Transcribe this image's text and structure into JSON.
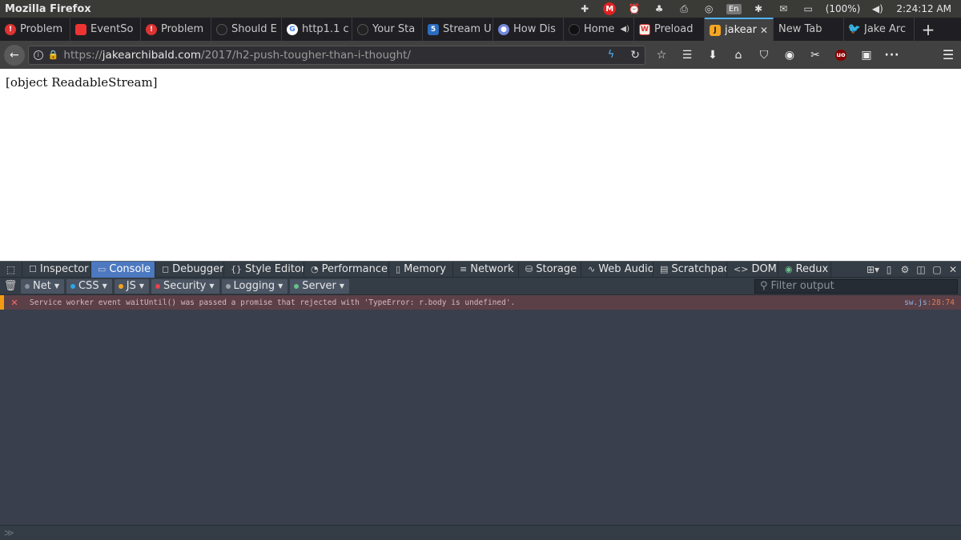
{
  "os": {
    "app_title": "Mozilla Firefox",
    "keyboard": "En",
    "battery": "(100%)",
    "clock": "2:24:12 AM"
  },
  "tabs": [
    {
      "label": "Problem",
      "favicon": "error-icon"
    },
    {
      "label": "EventSo",
      "favicon": "event-icon"
    },
    {
      "label": "Problem",
      "favicon": "error-icon"
    },
    {
      "label": "Should E",
      "favicon": "github-icon"
    },
    {
      "label": "http1.1 c",
      "favicon": "google-icon"
    },
    {
      "label": "Your Sta",
      "favicon": "github-icon"
    },
    {
      "label": "Stream U",
      "favicon": "css-icon"
    },
    {
      "label": "How Dis",
      "favicon": "discord-icon"
    },
    {
      "label": "Home",
      "favicon": "home-icon"
    },
    {
      "label": "Preload",
      "favicon": "ws-icon"
    },
    {
      "label": "jakear",
      "favicon": "j-icon",
      "active": true
    },
    {
      "label": "New Tab",
      "favicon": ""
    },
    {
      "label": "Jake Arc",
      "favicon": "twitter-icon"
    }
  ],
  "urlbar": {
    "scheme": "https://",
    "host": "jakearchibald.com",
    "path": "/2017/h2-push-tougher-than-i-thought/"
  },
  "page": {
    "content": "[object ReadableStream]"
  },
  "devtools": {
    "tabs": [
      {
        "label": "Inspector",
        "icon": "inspector-icon"
      },
      {
        "label": "Console",
        "icon": "console-icon",
        "active": true
      },
      {
        "label": "Debugger",
        "icon": "debugger-icon"
      },
      {
        "label": "Style Editor",
        "icon": "style-editor-icon"
      },
      {
        "label": "Performance",
        "icon": "performance-icon"
      },
      {
        "label": "Memory",
        "icon": "memory-icon"
      },
      {
        "label": "Network",
        "icon": "network-icon"
      },
      {
        "label": "Storage",
        "icon": "storage-icon"
      },
      {
        "label": "Web Audio",
        "icon": "web-audio-icon"
      },
      {
        "label": "Scratchpad",
        "icon": "scratchpad-icon"
      },
      {
        "label": "DOM",
        "icon": "dom-icon"
      },
      {
        "label": "Redux",
        "icon": "redux-icon"
      }
    ],
    "filters": [
      {
        "label": "Net",
        "color": "#8a929c"
      },
      {
        "label": "CSS",
        "color": "#2aa8e6"
      },
      {
        "label": "JS",
        "color": "#f7a21b"
      },
      {
        "label": "Security",
        "color": "#e8424a"
      },
      {
        "label": "Logging",
        "color": "#9ea4ac"
      },
      {
        "label": "Server",
        "color": "#6ac28a"
      }
    ],
    "filter_placeholder": "Filter output",
    "message": {
      "text": "Service worker event waitUntil() was passed a promise that rejected with 'TypeError: r.body is undefined'.",
      "file": "sw.js",
      "location": ":28:74"
    },
    "input_prompt": "≫"
  },
  "colors": {
    "active_tab_accent": "#4fb3ff",
    "devtools_bg": "#393f4c",
    "error_row_bg": "#5b4048",
    "error_marker": "#f39c12"
  }
}
